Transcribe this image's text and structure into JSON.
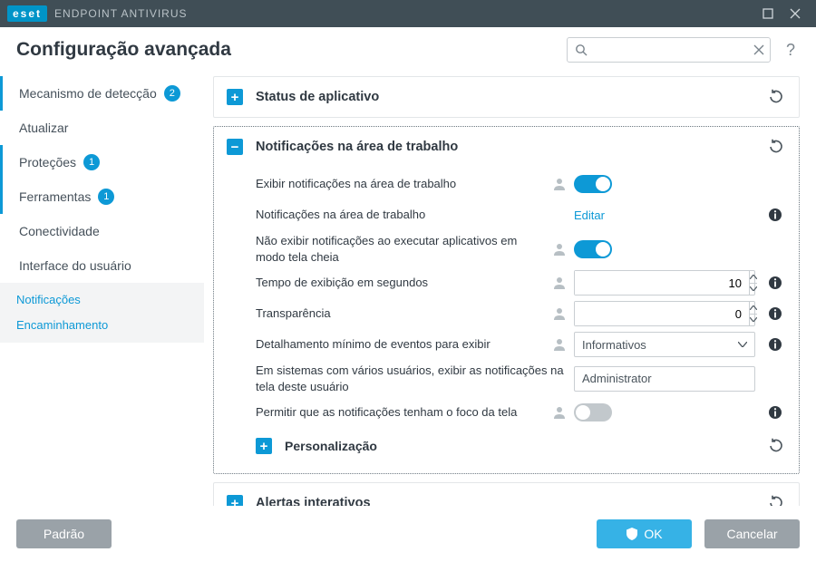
{
  "titlebar": {
    "logo": "eset",
    "product": "ENDPOINT ANTIVIRUS"
  },
  "header": {
    "title": "Configuração avançada",
    "search_placeholder": ""
  },
  "sidebar": {
    "items": [
      {
        "label": "Mecanismo de detecção",
        "badge": "2",
        "active": true
      },
      {
        "label": "Atualizar"
      },
      {
        "label": "Proteções",
        "badge": "1",
        "active": true
      },
      {
        "label": "Ferramentas",
        "badge": "1",
        "active": true
      },
      {
        "label": "Conectividade"
      },
      {
        "label": "Interface do usuário"
      }
    ],
    "sub": [
      {
        "label": "Notificações"
      },
      {
        "label": "Encaminhamento"
      }
    ]
  },
  "panels": {
    "status": {
      "title": "Status de aplicativo"
    },
    "desktop_notifications": {
      "title": "Notificações na área de trabalho",
      "rows": {
        "show_desktop": "Exibir notificações na área de trabalho",
        "desktop_link_label": "Notificações na área de trabalho",
        "desktop_link_action": "Editar",
        "fullscreen": "Não exibir notificações ao executar aplicativos em modo tela cheia",
        "timeout": "Tempo de exibição em segundos",
        "timeout_value": "10",
        "transparency": "Transparência",
        "transparency_value": "0",
        "min_verbosity": "Detalhamento mínimo de eventos para exibir",
        "min_verbosity_value": "Informativos",
        "multiuser": "Em sistemas com vários usuários, exibir as notificações na tela deste usuário",
        "multiuser_value": "Administrator",
        "focus": "Permitir que as notificações tenham o foco da tela"
      },
      "sub": {
        "title": "Personalização"
      }
    },
    "interactive": {
      "title": "Alertas interativos"
    }
  },
  "footer": {
    "default": "Padrão",
    "ok": "OK",
    "cancel": "Cancelar"
  }
}
